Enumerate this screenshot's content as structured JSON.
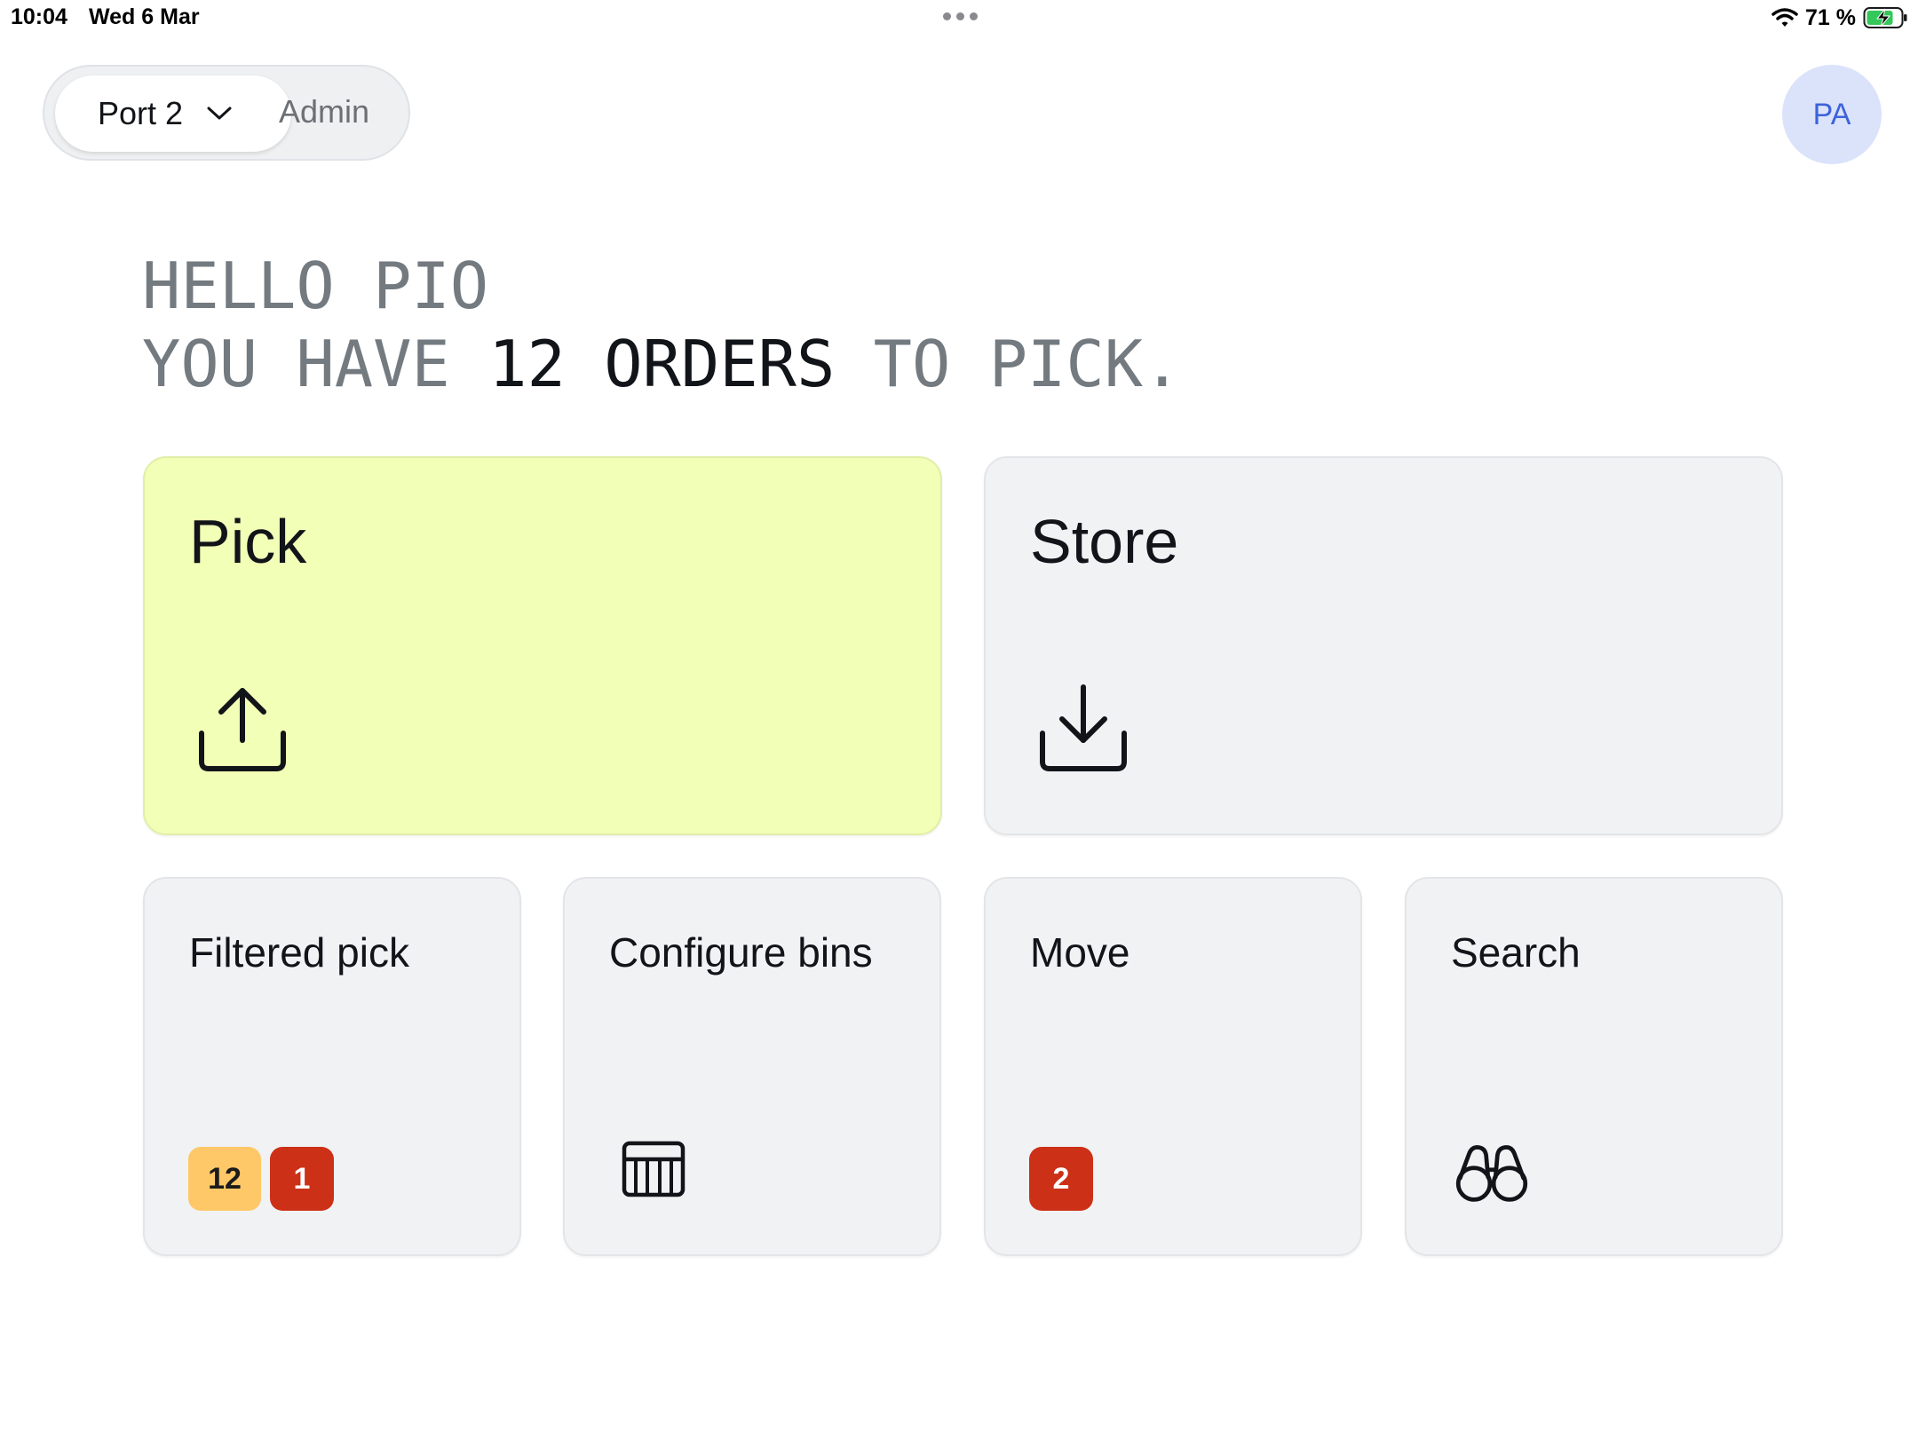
{
  "status_bar": {
    "time": "10:04",
    "date": "Wed 6 Mar",
    "battery": "71 %"
  },
  "header": {
    "port_label": "Port 2",
    "mode_label": "Admin",
    "avatar_initials": "PA"
  },
  "greeting": {
    "line1": "HELLO PIO",
    "line2_prefix": "YOU HAVE ",
    "line2_count": "12",
    "line2_space": " ",
    "line2_object": "ORDERS",
    "line2_suffix": " TO PICK."
  },
  "tiles": {
    "pick": {
      "title": "Pick",
      "icon": "upload-tray-icon"
    },
    "store": {
      "title": "Store",
      "icon": "download-tray-icon"
    },
    "filtered_pick": {
      "title": "Filtered pick",
      "badges": [
        "12",
        "1"
      ]
    },
    "configure_bins": {
      "title": "Configure bins",
      "icon": "bins-grid-icon"
    },
    "move": {
      "title": "Move",
      "badges": [
        "2"
      ]
    },
    "search": {
      "title": "Search",
      "icon": "binoculars-icon"
    }
  },
  "colors": {
    "pick_tile": "#f2ffb6",
    "tile_bg": "#f1f2f4",
    "badge_warning": "#fec868",
    "badge_danger": "#cc3016",
    "avatar_bg": "#dbe3fb",
    "avatar_text": "#3d63d8"
  }
}
